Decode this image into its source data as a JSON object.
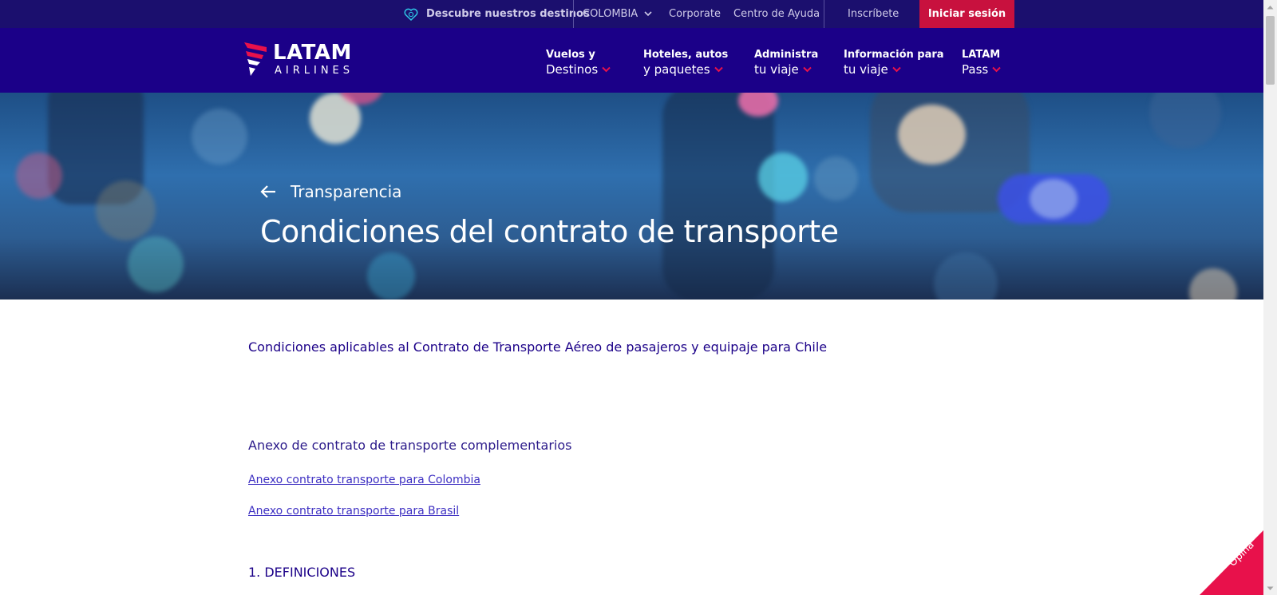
{
  "topbar": {
    "destinations_label": "Descubre nuestros destinos",
    "country": "COLOMBIA",
    "corporate": "Corporate",
    "help_center": "Centro de Ayuda",
    "signup": "Inscríbete",
    "login": "Iniciar sesión"
  },
  "brand": {
    "name": "LATAM",
    "sub": "AIRLINES"
  },
  "nav": [
    {
      "line1": "Vuelos y",
      "line2": "Destinos"
    },
    {
      "line1": "Hoteles, autos",
      "line2": "y paquetes"
    },
    {
      "line1": "Administra",
      "line2": "tu viaje"
    },
    {
      "line1": "Información para",
      "line2": "tu viaje"
    },
    {
      "line1": "LATAM",
      "line2": "Pass"
    }
  ],
  "hero": {
    "breadcrumb": "Transparencia",
    "title": "Condiciones del contrato de transporte"
  },
  "content": {
    "subtitle": "Condiciones aplicables al Contrato de Transporte Aéreo de pasajeros y equipaje para Chile",
    "annex_heading": "Anexo de contrato de transporte complementarios",
    "links": [
      "Anexo contrato transporte para Colombia",
      "Anexo contrato transporte para Brasil"
    ],
    "section1": "1. DEFINICIONES"
  },
  "feedback": {
    "label": "Opina"
  },
  "colors": {
    "topbar_bg": "#1b0f6e",
    "nav_bg": "#1b0088",
    "login_bg": "#c8113e",
    "accent_pink": "#e8114b",
    "accent_cyan": "#2ec8e6"
  }
}
